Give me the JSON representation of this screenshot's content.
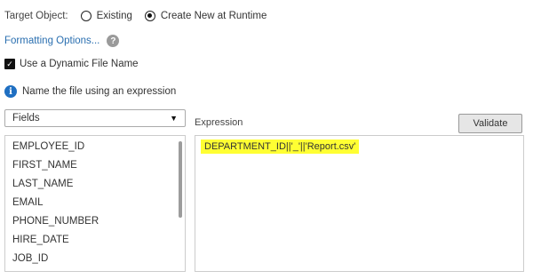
{
  "target": {
    "label": "Target Object:",
    "options": [
      {
        "label": "Existing",
        "selected": false
      },
      {
        "label": "Create New at Runtime",
        "selected": true
      }
    ]
  },
  "formatting": {
    "link_label": "Formatting Options...",
    "help_glyph": "?"
  },
  "dynamic_file": {
    "label": "Use a Dynamic File Name",
    "checked": true
  },
  "info": {
    "glyph": "i",
    "text": "Name the file using an expression"
  },
  "fields": {
    "select_value": "Fields",
    "items": [
      "EMPLOYEE_ID",
      "FIRST_NAME",
      "LAST_NAME",
      "EMAIL",
      "PHONE_NUMBER",
      "HIRE_DATE",
      "JOB_ID"
    ]
  },
  "expression": {
    "label": "Expression",
    "value": "DEPARTMENT_ID||'_'||'Report.csv'",
    "highlight_color": "#ffff33"
  },
  "validate_label": "Validate",
  "colors": {
    "link": "#2a6fb0",
    "info": "#1f6fc2"
  }
}
